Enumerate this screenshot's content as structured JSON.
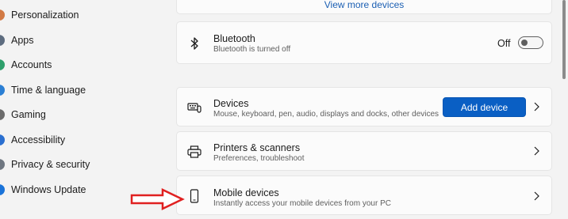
{
  "sidebar": {
    "items": [
      {
        "label": "Personalization",
        "icon": "personalization-icon"
      },
      {
        "label": "Apps",
        "icon": "apps-icon"
      },
      {
        "label": "Accounts",
        "icon": "accounts-icon"
      },
      {
        "label": "Time & language",
        "icon": "time-language-icon"
      },
      {
        "label": "Gaming",
        "icon": "gaming-icon"
      },
      {
        "label": "Accessibility",
        "icon": "accessibility-icon"
      },
      {
        "label": "Privacy & security",
        "icon": "privacy-security-icon"
      },
      {
        "label": "Windows Update",
        "icon": "windows-update-icon"
      }
    ]
  },
  "main": {
    "view_more": "View more devices",
    "bluetooth": {
      "title": "Bluetooth",
      "subtitle": "Bluetooth is turned off",
      "toggle_state": "Off",
      "icon": "bluetooth-icon"
    },
    "devices": {
      "title": "Devices",
      "subtitle": "Mouse, keyboard, pen, audio, displays and docks, other devices",
      "button_label": "Add device",
      "icon": "devices-icon"
    },
    "printers": {
      "title": "Printers & scanners",
      "subtitle": "Preferences, troubleshoot",
      "icon": "printer-icon"
    },
    "mobile": {
      "title": "Mobile devices",
      "subtitle": "Instantly access your mobile devices from your PC",
      "icon": "mobile-device-icon"
    }
  },
  "colors": {
    "accent": "#0a5fc4",
    "annotation_arrow": "#e02020",
    "background": "#f3f3f3",
    "card": "#fbfbfb"
  }
}
